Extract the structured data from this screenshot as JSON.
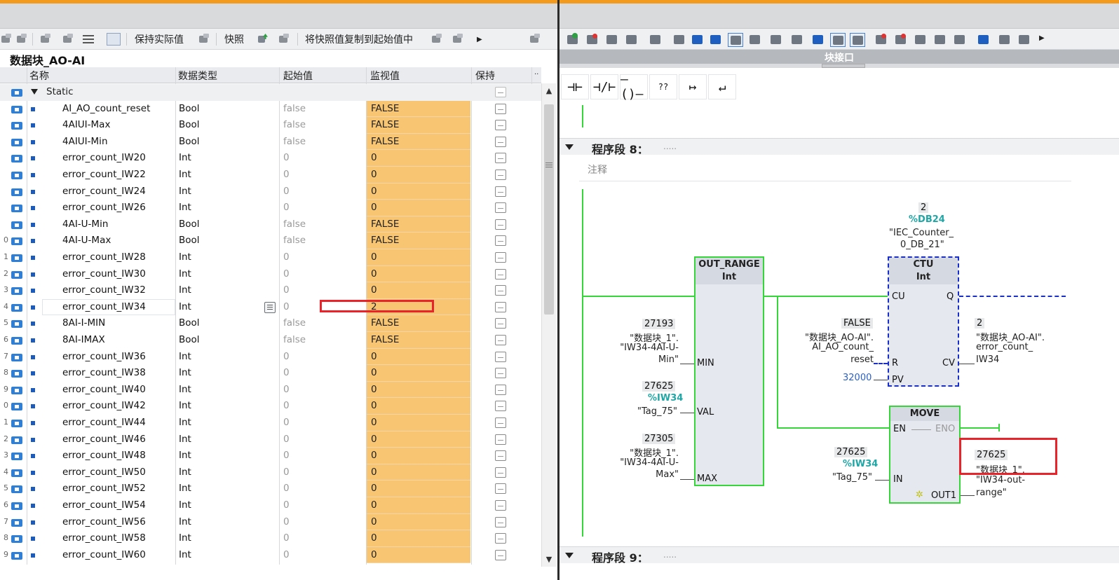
{
  "left": {
    "toolbar": {
      "keep_actual": "保持实际值",
      "snapshot": "快照",
      "copy_snapshot": "将快照值复制到起始值中"
    },
    "db_title": "数据块_AO-AI",
    "headers": {
      "name": "名称",
      "type": "数据类型",
      "start": "起始值",
      "monitor": "监视值",
      "retain": "保持"
    },
    "static_label": "Static",
    "rows": [
      {
        "num": "",
        "name": "AI_AO_count_reset",
        "type": "Bool",
        "start": "false",
        "monitor": "FALSE"
      },
      {
        "num": "",
        "name": "4AIUI-Max",
        "type": "Bool",
        "start": "false",
        "monitor": "FALSE"
      },
      {
        "num": "",
        "name": "4AIUI-Min",
        "type": "Bool",
        "start": "false",
        "monitor": "FALSE"
      },
      {
        "num": "",
        "name": "error_count_IW20",
        "type": "Int",
        "start": "0",
        "monitor": "0"
      },
      {
        "num": "",
        "name": "error_count_IW22",
        "type": "Int",
        "start": "0",
        "monitor": "0"
      },
      {
        "num": "",
        "name": "error_count_IW24",
        "type": "Int",
        "start": "0",
        "monitor": "0"
      },
      {
        "num": "",
        "name": "error_count_IW26",
        "type": "Int",
        "start": "0",
        "monitor": "0"
      },
      {
        "num": "",
        "name": "4AI-U-Min",
        "type": "Bool",
        "start": "false",
        "monitor": "FALSE"
      },
      {
        "num": "0",
        "name": "4AI-U-Max",
        "type": "Bool",
        "start": "false",
        "monitor": "FALSE"
      },
      {
        "num": "1",
        "name": "error_count_IW28",
        "type": "Int",
        "start": "0",
        "monitor": "0"
      },
      {
        "num": "2",
        "name": "error_count_IW30",
        "type": "Int",
        "start": "0",
        "monitor": "0"
      },
      {
        "num": "3",
        "name": "error_count_IW32",
        "type": "Int",
        "start": "0",
        "monitor": "0"
      },
      {
        "num": "4",
        "name": "error_count_IW34",
        "type": "Int",
        "start": "0",
        "monitor": "2",
        "selected": true
      },
      {
        "num": "5",
        "name": "8AI-I-MIN",
        "type": "Bool",
        "start": "false",
        "monitor": "FALSE"
      },
      {
        "num": "6",
        "name": "8AI-IMAX",
        "type": "Bool",
        "start": "false",
        "monitor": "FALSE"
      },
      {
        "num": "7",
        "name": "error_count_IW36",
        "type": "Int",
        "start": "0",
        "monitor": "0"
      },
      {
        "num": "8",
        "name": "error_count_IW38",
        "type": "Int",
        "start": "0",
        "monitor": "0"
      },
      {
        "num": "9",
        "name": "error_count_IW40",
        "type": "Int",
        "start": "0",
        "monitor": "0"
      },
      {
        "num": "0",
        "name": "error_count_IW42",
        "type": "Int",
        "start": "0",
        "monitor": "0"
      },
      {
        "num": "1",
        "name": "error_count_IW44",
        "type": "Int",
        "start": "0",
        "monitor": "0"
      },
      {
        "num": "2",
        "name": "error_count_IW46",
        "type": "Int",
        "start": "0",
        "monitor": "0"
      },
      {
        "num": "3",
        "name": "error_count_IW48",
        "type": "Int",
        "start": "0",
        "monitor": "0"
      },
      {
        "num": "4",
        "name": "error_count_IW50",
        "type": "Int",
        "start": "0",
        "monitor": "0"
      },
      {
        "num": "5",
        "name": "error_count_IW52",
        "type": "Int",
        "start": "0",
        "monitor": "0"
      },
      {
        "num": "6",
        "name": "error_count_IW54",
        "type": "Int",
        "start": "0",
        "monitor": "0"
      },
      {
        "num": "7",
        "name": "error_count_IW56",
        "type": "Int",
        "start": "0",
        "monitor": "0"
      },
      {
        "num": "8",
        "name": "error_count_IW58",
        "type": "Int",
        "start": "0",
        "monitor": "0"
      },
      {
        "num": "9",
        "name": "error_count_IW60",
        "type": "Int",
        "start": "0",
        "monitor": "0"
      }
    ]
  },
  "right": {
    "interface_label": "块接口",
    "ladder_buttons": [
      "⊣⊢",
      "⊣/⊢",
      "–()–",
      "??",
      "↦",
      "↵"
    ],
    "segment8": {
      "title": "程序段 8：",
      "dots": "....."
    },
    "comment": "注释",
    "segment9": {
      "title": "程序段 9：",
      "dots": "....."
    },
    "out_range": {
      "title1": "OUT_RANGE",
      "title2": "Int",
      "min_val": "27193",
      "min_tag1": "\"数据块_1\".",
      "min_tag2": "\"IW34-4AI-U-",
      "min_tag3": "Min\"",
      "val_val": "27625",
      "val_addr": "%IW34",
      "val_tag": "\"Tag_75\"",
      "max_val": "27305",
      "max_tag1": "\"数据块_1\".",
      "max_tag2": "\"IW34-4AI-U-",
      "max_tag3": "Max\"",
      "pin_min": "MIN",
      "pin_val": "VAL",
      "pin_max": "MAX"
    },
    "ctu": {
      "count": "2",
      "db": "%DB24",
      "inst1": "\"IEC_Counter_",
      "inst2": "0_DB_21\"",
      "title1": "CTU",
      "title2": "Int",
      "pin_cu": "CU",
      "pin_q": "Q",
      "pin_r": "R",
      "pin_cv": "CV",
      "pin_pv": "PV",
      "r_val": "FALSE",
      "r_tag1": "\"数据块_AO-AI\".",
      "r_tag2": "AI_AO_count_",
      "r_tag3": "reset",
      "pv_val": "32000",
      "cv_val": "2",
      "cv_tag1": "\"数据块_AO-AI\".",
      "cv_tag2": "error_count_",
      "cv_tag3": "IW34"
    },
    "move": {
      "title": "MOVE",
      "pin_en": "EN",
      "pin_eno": "ENO",
      "pin_in": "IN",
      "pin_out": "OUT1",
      "in_val": "27625",
      "in_addr": "%IW34",
      "in_tag": "\"Tag_75\"",
      "out_val": "27625",
      "out_tag1": "\"数据块_1\".",
      "out_tag2": "\"IW34-out-",
      "out_tag3": "range\""
    }
  }
}
